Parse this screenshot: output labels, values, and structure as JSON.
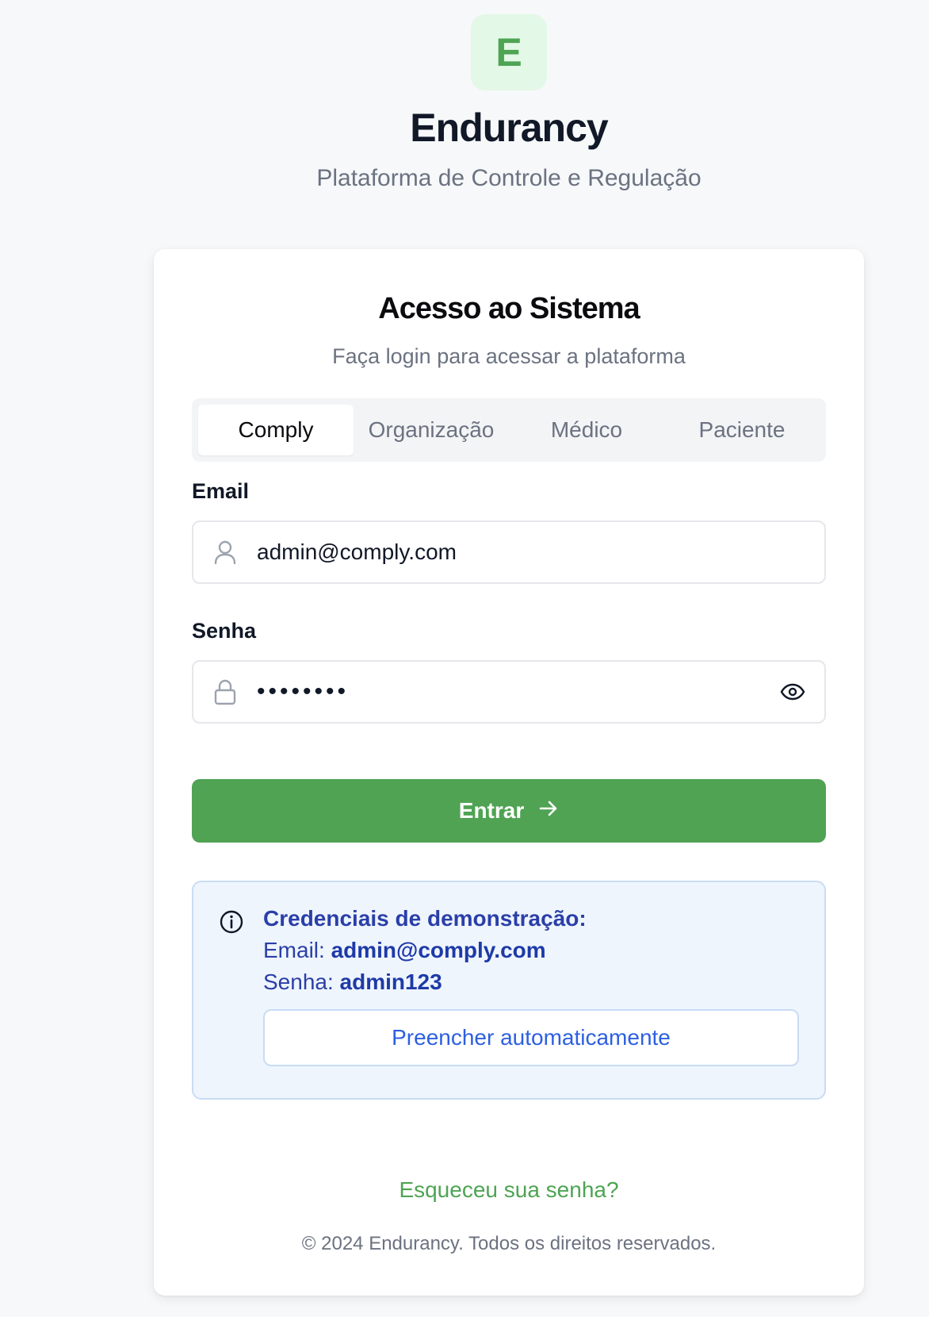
{
  "brand": {
    "logo_letter": "E",
    "name": "Endurancy",
    "subtitle": "Plataforma de Controle e Regulação"
  },
  "login": {
    "title": "Acesso ao Sistema",
    "subtitle": "Faça login para acessar a plataforma",
    "tabs": [
      {
        "label": "Comply",
        "active": true
      },
      {
        "label": "Organização",
        "active": false
      },
      {
        "label": "Médico",
        "active": false
      },
      {
        "label": "Paciente",
        "active": false
      }
    ],
    "email_label": "Email",
    "email_value": "admin@comply.com",
    "password_label": "Senha",
    "password_value": "admin123",
    "submit_label": "Entrar",
    "icons": {
      "user": "user-icon",
      "lock": "lock-icon",
      "eye": "eye-icon",
      "arrow": "arrow-right-icon",
      "info": "info-icon"
    }
  },
  "demo": {
    "heading": "Credenciais de demonstração:",
    "email_prefix": "Email: ",
    "email": "admin@comply.com",
    "password_prefix": "Senha: ",
    "password": "admin123",
    "autofill_label": "Preencher automaticamente"
  },
  "footer": {
    "forgot": "Esqueceu sua senha?",
    "copyright": "© 2024 Endurancy. Todos os direitos reservados."
  },
  "colors": {
    "accent": "#4fa353",
    "logo_bg": "#e3f8e6",
    "info_bg": "#eff5fd",
    "info_text": "#2a3fa8",
    "link_blue": "#2d5fe0"
  }
}
